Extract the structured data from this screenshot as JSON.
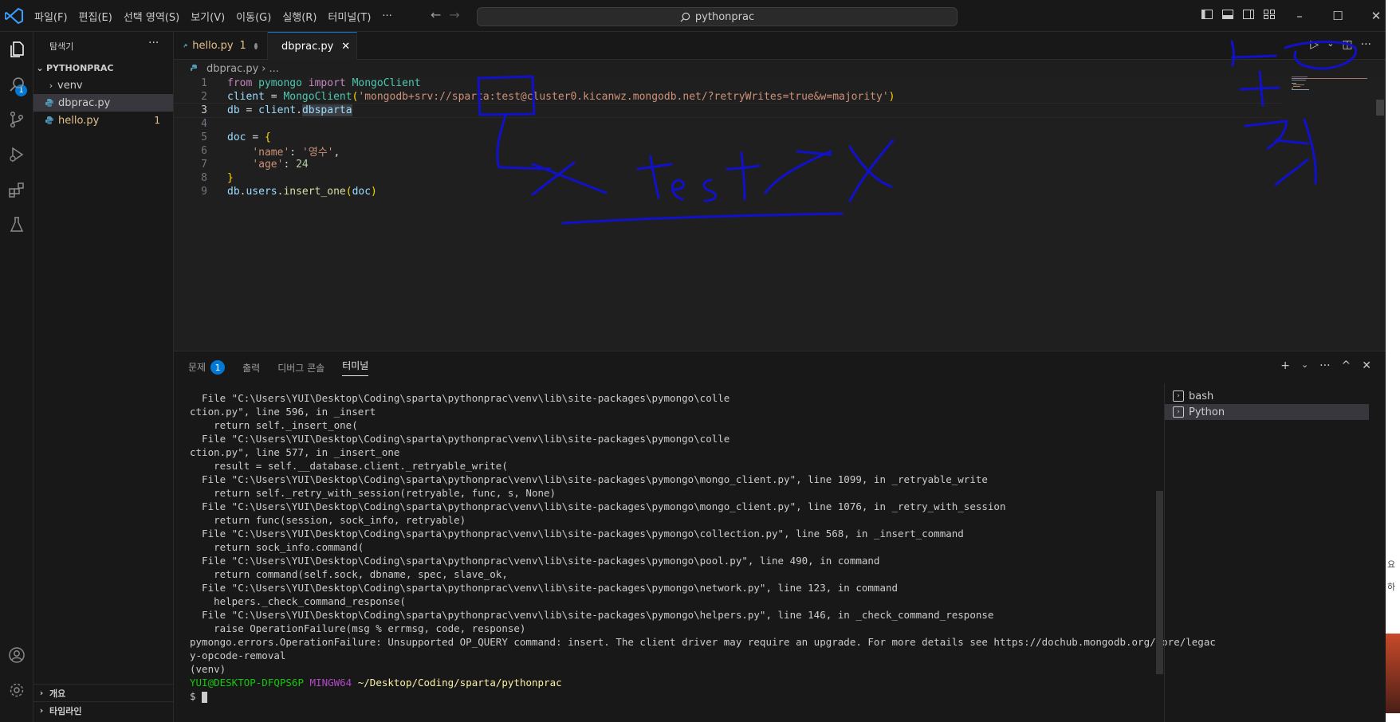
{
  "titlebar": {
    "menu": [
      "파일(F)",
      "편집(E)",
      "선택 영역(S)",
      "보기(V)",
      "이동(G)",
      "실행(R)",
      "터미널(T)",
      "···"
    ],
    "search": "pythonprac",
    "window_controls": [
      "–",
      "☐",
      "✕"
    ]
  },
  "activity_bar": {
    "icons": [
      "files-icon",
      "search-icon",
      "source-control-icon",
      "run-debug-icon",
      "extensions-icon",
      "testing-icon",
      "account-icon",
      "settings-gear-icon"
    ],
    "explorer_badge": "1"
  },
  "sidebar": {
    "title": "탐색기",
    "more": "···",
    "root": "PYTHONPRAC",
    "items": [
      {
        "label": "venv",
        "type": "folder"
      },
      {
        "label": "dbprac.py",
        "type": "file",
        "selected": true
      },
      {
        "label": "hello.py",
        "type": "file",
        "problems": "1"
      }
    ],
    "sections": [
      "개요",
      "타임라인"
    ]
  },
  "tabs": [
    {
      "label": "hello.py",
      "suffix": "1",
      "modified": true
    },
    {
      "label": "dbprac.py",
      "active": true,
      "close": "✕"
    }
  ],
  "breadcrumb": {
    "file": "dbprac.py",
    "rest": "..."
  },
  "editor": {
    "lines": [
      {
        "n": "1",
        "text": "from pymongo import MongoClient"
      },
      {
        "n": "2",
        "text": "client = MongoClient('mongodb+srv://sparta:test@cluster0.kicanwz.mongodb.net/?retryWrites=true&w=majority')"
      },
      {
        "n": "3",
        "text": "db = client.dbsparta"
      },
      {
        "n": "4",
        "text": ""
      },
      {
        "n": "5",
        "text": "doc = {"
      },
      {
        "n": "6",
        "text": "    'name': '영수',"
      },
      {
        "n": "7",
        "text": "    'age': 24"
      },
      {
        "n": "8",
        "text": "}"
      },
      {
        "n": "9",
        "text": "db.users.insert_one(doc)"
      }
    ]
  },
  "panel": {
    "tabs": [
      {
        "label": "문제",
        "badge": "1"
      },
      {
        "label": "출력"
      },
      {
        "label": "디버그 콘솔"
      },
      {
        "label": "터미널",
        "active": true
      }
    ],
    "actions": [
      "+",
      "⌄",
      "···",
      "^",
      "✕"
    ],
    "terminal_lines": [
      "  File \"C:\\Users\\YUI\\Desktop\\Coding\\sparta\\pythonprac\\venv\\lib\\site-packages\\pymongo\\colle",
      "ction.py\", line 596, in _insert",
      "    return self._insert_one(",
      "  File \"C:\\Users\\YUI\\Desktop\\Coding\\sparta\\pythonprac\\venv\\lib\\site-packages\\pymongo\\colle",
      "ction.py\", line 577, in _insert_one",
      "    result = self.__database.client._retryable_write(",
      "  File \"C:\\Users\\YUI\\Desktop\\Coding\\sparta\\pythonprac\\venv\\lib\\site-packages\\pymongo\\mongo_client.py\", line 1099, in _retryable_write",
      "    return self._retry_with_session(retryable, func, s, None)",
      "  File \"C:\\Users\\YUI\\Desktop\\Coding\\sparta\\pythonprac\\venv\\lib\\site-packages\\pymongo\\mongo_client.py\", line 1076, in _retry_with_session",
      "    return func(session, sock_info, retryable)",
      "  File \"C:\\Users\\YUI\\Desktop\\Coding\\sparta\\pythonprac\\venv\\lib\\site-packages\\pymongo\\collection.py\", line 568, in _insert_command",
      "    return sock_info.command(",
      "  File \"C:\\Users\\YUI\\Desktop\\Coding\\sparta\\pythonprac\\venv\\lib\\site-packages\\pymongo\\pool.py\", line 490, in command",
      "    return command(self.sock, dbname, spec, slave_ok,",
      "  File \"C:\\Users\\YUI\\Desktop\\Coding\\sparta\\pythonprac\\venv\\lib\\site-packages\\pymongo\\network.py\", line 123, in command",
      "    helpers._check_command_response(",
      "  File \"C:\\Users\\YUI\\Desktop\\Coding\\sparta\\pythonprac\\venv\\lib\\site-packages\\pymongo\\helpers.py\", line 146, in _check_command_response",
      "    raise OperationFailure(msg % errmsg, code, response)",
      "pymongo.errors.OperationFailure: Unsupported OP_QUERY command: insert. The client driver may require an upgrade. For more details see https://dochub.mongodb.org/core/legac",
      "y-opcode-removal",
      "(venv)"
    ],
    "prompt": {
      "user": "YUI@DESKTOP-DFQPS6P",
      "host": "MINGW64",
      "path": "~/Desktop/Coding/sparta/pythonprac",
      "symbol": "$"
    },
    "terminals": [
      {
        "label": "bash"
      },
      {
        "label": "Python",
        "active": true
      }
    ]
  },
  "edge_strip": {
    "chars": [
      "요",
      "하"
    ]
  },
  "colors": {
    "accent": "#0078d4",
    "annotation": "#1111cc"
  }
}
